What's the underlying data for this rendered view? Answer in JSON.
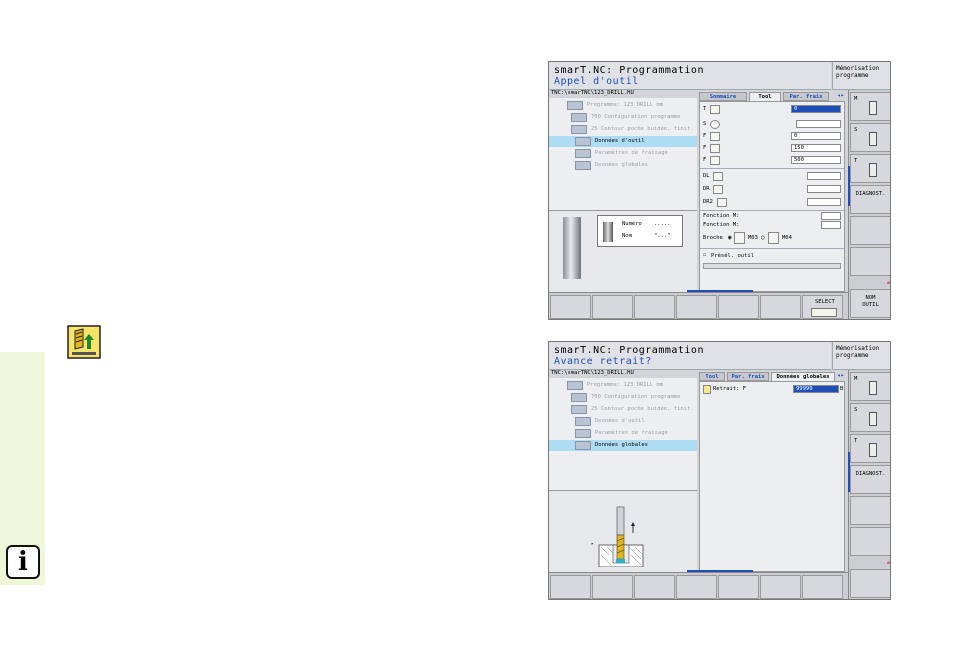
{
  "icons": {
    "info": "info-icon",
    "tool_call": "tool-call-icon"
  },
  "info_icon_letter": "i",
  "shot1": {
    "title": "smarT.NC: Programmation",
    "subtitle": "Appel d'outil",
    "header_right": [
      "Mémorisation",
      "programme"
    ],
    "path": "TNC:\\smarTNC\\123_DRILL.HU",
    "tree": [
      {
        "label": "Programme: 123_DRILL mm",
        "selected": false
      },
      {
        "label": "700 Configuration programme",
        "selected": false
      },
      {
        "label": "25 Contour poche buidée, finit",
        "selected": false
      },
      {
        "label": "Données d'outil",
        "selected": true
      },
      {
        "label": "Paramètres de fraisage",
        "selected": false
      },
      {
        "label": "Données globales",
        "selected": false
      }
    ],
    "preview_box": {
      "numero_label": "Numéro",
      "numero_value": ".....",
      "nom_label": "Nom",
      "nom_value": "\"...\""
    },
    "tabs": [
      "Sommaire",
      "Tool",
      "Par. frais"
    ],
    "tab_arrow": "◂▸",
    "fields": [
      {
        "key": "T",
        "value": "0",
        "highlight": true
      },
      {
        "key": "S",
        "value": "",
        "highlight": false
      },
      {
        "key": "F",
        "value": "0",
        "highlight": false
      },
      {
        "key": "F",
        "value": "150",
        "highlight": false
      },
      {
        "key": "F",
        "value": "500",
        "highlight": false
      },
      {
        "key": "DL",
        "value": "",
        "highlight": false
      },
      {
        "key": "DR",
        "value": "",
        "highlight": false
      },
      {
        "key": "DR2",
        "value": "",
        "highlight": false
      }
    ],
    "fonction1": "Fonction M:",
    "fonction2": "Fonction M:",
    "broche_label": "Broche",
    "m03": "M03",
    "m04": "M04",
    "premsel": "Présél. outil",
    "softkey_select": "SELECT",
    "rbar": [
      "M",
      "S",
      "T",
      "DIAGNOST.",
      "",
      "",
      "NOM OUTIL"
    ],
    "nom_outil": [
      "NOM",
      "OUTIL"
    ]
  },
  "shot2": {
    "title": "smarT.NC: Programmation",
    "subtitle": "Avance retrait?",
    "header_right": [
      "Mémorisation",
      "programme"
    ],
    "path": "TNC:\\smarTNC\\123_DRILL.HU",
    "tree": [
      {
        "label": "Programme: 123_DRILL mm",
        "selected": false
      },
      {
        "label": "700 Configuration programme",
        "selected": false
      },
      {
        "label": "25 Contour poche buidée, finit",
        "selected": false
      },
      {
        "label": "Données d'outil",
        "selected": false
      },
      {
        "label": "Paramètres de fraisage",
        "selected": false
      },
      {
        "label": "Données globales",
        "selected": true
      }
    ],
    "tabs": [
      "Tool",
      "Par. frais",
      "Données globales"
    ],
    "tab_arrow": "◂▸",
    "retrait_label": "Retrait: F",
    "retrait_value": "99999",
    "retrait_marker": "B",
    "rbar": [
      "M",
      "S",
      "T",
      "DIAGNOST."
    ]
  }
}
